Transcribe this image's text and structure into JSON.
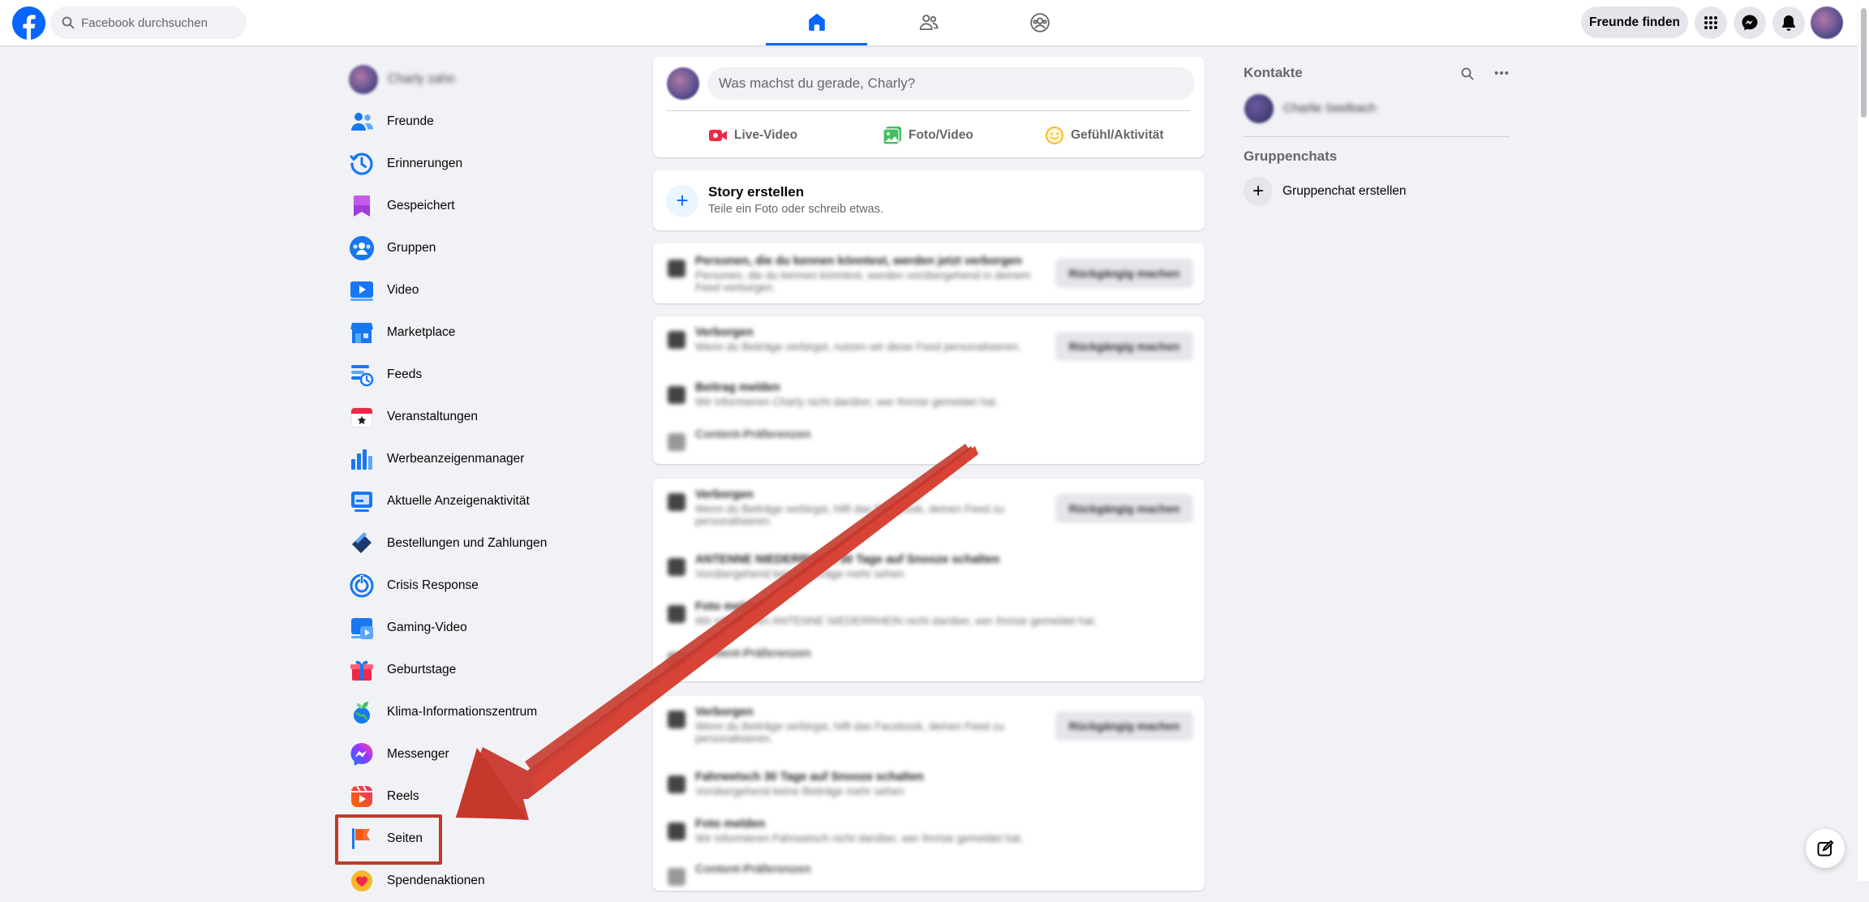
{
  "header": {
    "search_placeholder": "Facebook durchsuchen",
    "find_friends_label": "Freunde finden",
    "nav_tabs": [
      "home-icon",
      "friends-icon",
      "groups-icon"
    ],
    "active_tab": "home",
    "brand_color": "#0866ff"
  },
  "sidebar": {
    "profile_name": "Charly zahn",
    "items": [
      {
        "label": "Freunde",
        "icon": "friends-icon"
      },
      {
        "label": "Erinnerungen",
        "icon": "memories-icon"
      },
      {
        "label": "Gespeichert",
        "icon": "bookmark-icon"
      },
      {
        "label": "Gruppen",
        "icon": "groups-icon"
      },
      {
        "label": "Video",
        "icon": "video-icon"
      },
      {
        "label": "Marketplace",
        "icon": "marketplace-icon"
      },
      {
        "label": "Feeds",
        "icon": "feeds-icon"
      },
      {
        "label": "Veranstaltungen",
        "icon": "calendar-icon"
      },
      {
        "label": "Werbeanzeigenmanager",
        "icon": "ads-manager-icon"
      },
      {
        "label": "Aktuelle Anzeigenaktivität",
        "icon": "ad-activity-icon"
      },
      {
        "label": "Bestellungen und Zahlungen",
        "icon": "payments-icon"
      },
      {
        "label": "Crisis Response",
        "icon": "crisis-response-icon"
      },
      {
        "label": "Gaming-Video",
        "icon": "gaming-video-icon"
      },
      {
        "label": "Geburtstage",
        "icon": "gift-icon"
      },
      {
        "label": "Klima-Informationszentrum",
        "icon": "climate-icon"
      },
      {
        "label": "Messenger",
        "icon": "messenger-icon"
      },
      {
        "label": "Reels",
        "icon": "reels-icon"
      },
      {
        "label": "Seiten",
        "icon": "flag-icon"
      },
      {
        "label": "Spendenaktionen",
        "icon": "fundraiser-icon"
      }
    ],
    "highlighted_item": "Seiten",
    "highlight_color": "#c0392b"
  },
  "composer": {
    "placeholder": "Was machst du gerade, Charly?",
    "actions": [
      {
        "label": "Live-Video",
        "icon": "live-video-icon"
      },
      {
        "label": "Foto/Video",
        "icon": "photo-icon"
      },
      {
        "label": "Gefühl/Aktivität",
        "icon": "feeling-icon"
      }
    ]
  },
  "story": {
    "title": "Story erstellen",
    "subtitle": "Teile ein Foto oder schreib etwas."
  },
  "feed_blurred": {
    "card1": {
      "title": "Personen, die du kennen könntest, werden jetzt verborgen",
      "subtitle": "Personen, die du kennen könntest, werden vorübergehend in deinem Feed verborgen.",
      "button": "Rückgängig machen"
    },
    "card2": {
      "rows": [
        {
          "title": "Verborgen",
          "subtitle": "Wenn du Beiträge verbirgst, nutzen wir diese Feed personalisieren."
        },
        {
          "title": "Beitrag melden",
          "subtitle": "Wir informieren Charly nicht darüber, wer ihn/sie gemeldet hat."
        },
        {
          "title": "Content-Präferenzen",
          "subtitle": ""
        }
      ],
      "button": "Rückgängig machen"
    },
    "card3": {
      "rows": [
        {
          "title": "Verborgen",
          "subtitle": "Wenn du Beiträge verbirgst, hilft das Facebook, deinen Feed zu personalisieren."
        },
        {
          "title": "ANTENNE NIEDERRHEIN 30 Tage auf Snooze schalten",
          "subtitle": "Vorübergehend keine Beiträge mehr sehen"
        },
        {
          "title": "Foto melden",
          "subtitle": "Wir informieren ANTENNE NIEDERRHEIN nicht darüber, wer ihn/sie gemeldet hat."
        },
        {
          "title": "Content-Präferenzen",
          "subtitle": ""
        }
      ],
      "button": "Rückgängig machen"
    },
    "card4": {
      "rows": [
        {
          "title": "Verborgen",
          "subtitle": "Wenn du Beiträge verbirgst, hilft das Facebook, deinen Feed zu personalisieren."
        },
        {
          "title": "Fahrwetsch 30 Tage auf Snooze schalten",
          "subtitle": "Vorübergehend keine Beiträge mehr sehen"
        },
        {
          "title": "Foto melden",
          "subtitle": "Wir informieren Fahrwetsch nicht darüber, wer ihn/sie gemeldet hat."
        },
        {
          "title": "Content-Präferenzen",
          "subtitle": ""
        }
      ],
      "button": "Rückgängig machen"
    }
  },
  "rightcol": {
    "contacts_title": "Kontakte",
    "contact_name": "Charlie Seelbach",
    "group_chats_title": "Gruppenchats",
    "create_group_chat": "Gruppenchat erstellen"
  }
}
